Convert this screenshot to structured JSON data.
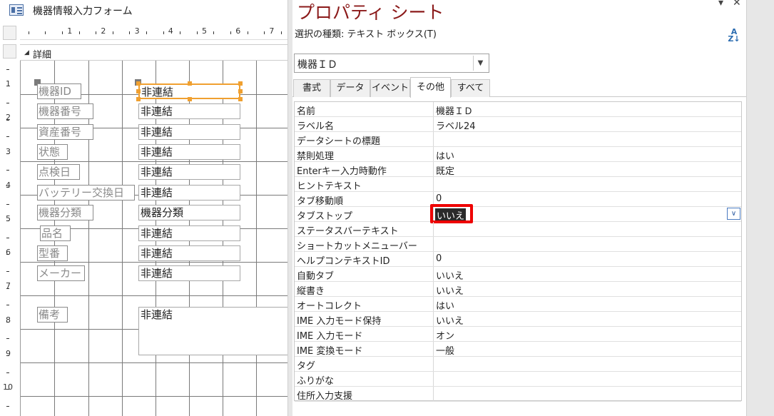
{
  "window": {
    "form_title": "機器情報入力フォーム",
    "section_label": "詳細"
  },
  "ruler": {
    "horizontal": [
      "1",
      "2",
      "3",
      "4",
      "5",
      "6",
      "7"
    ],
    "vertical": [
      "1",
      "2",
      "3",
      "4",
      "5",
      "6",
      "7",
      "8",
      "9",
      "10"
    ]
  },
  "form": {
    "controls": [
      {
        "label": "機器ID",
        "value": "非連結"
      },
      {
        "label": "機器番号",
        "value": "非連結"
      },
      {
        "label": "資産番号",
        "value": "非連結"
      },
      {
        "label": "状態",
        "value": "非連結"
      },
      {
        "label": "点検日",
        "value": "非連結"
      },
      {
        "label": "バッテリー交換日",
        "value": "非連結"
      },
      {
        "label": "機器分類",
        "value": "機器分類"
      },
      {
        "label": "品名",
        "value": "非連結"
      },
      {
        "label": "型番",
        "value": "非連結"
      },
      {
        "label": "メーカー",
        "value": "非連結"
      },
      {
        "label": "備考",
        "value": "非連結"
      }
    ]
  },
  "property_sheet": {
    "title": "プロパティ シート",
    "selection_type": "選択の種類: テキスト ボックス(T)",
    "sort_icon": "sort-az-icon",
    "object_selector": "機器ＩＤ",
    "tabs": [
      {
        "label": "書式",
        "active": false
      },
      {
        "label": "データ",
        "active": false
      },
      {
        "label": "イベント",
        "active": false
      },
      {
        "label": "その他",
        "active": true
      },
      {
        "label": "すべて",
        "active": false
      }
    ],
    "properties": [
      {
        "name": "名前",
        "value": "機器ＩＤ"
      },
      {
        "name": "ラベル名",
        "value": "ラベル24"
      },
      {
        "name": "データシートの標題",
        "value": ""
      },
      {
        "name": "禁則処理",
        "value": "はい"
      },
      {
        "name": "Enterキー入力時動作",
        "value": "既定"
      },
      {
        "name": "ヒントテキスト",
        "value": ""
      },
      {
        "name": "タブ移動順",
        "value": "0"
      },
      {
        "name": "タブストップ",
        "value": "いいえ"
      },
      {
        "name": "ステータスバーテキスト",
        "value": ""
      },
      {
        "name": "ショートカットメニューバー",
        "value": ""
      },
      {
        "name": "ヘルプコンテキストID",
        "value": "0"
      },
      {
        "name": "自動タブ",
        "value": "いいえ"
      },
      {
        "name": "縦書き",
        "value": "いいえ"
      },
      {
        "name": "オートコレクト",
        "value": "はい"
      },
      {
        "name": "IME 入力モード保持",
        "value": "いいえ"
      },
      {
        "name": "IME 入力モード",
        "value": "オン"
      },
      {
        "name": "IME 変換モード",
        "value": "一般"
      },
      {
        "name": "タグ",
        "value": ""
      },
      {
        "name": "ふりがな",
        "value": ""
      },
      {
        "name": "住所入力支援",
        "value": ""
      }
    ],
    "selected_property_index": 7,
    "highlight_color": "#ee0000",
    "title_color": "#8b1a1a"
  }
}
